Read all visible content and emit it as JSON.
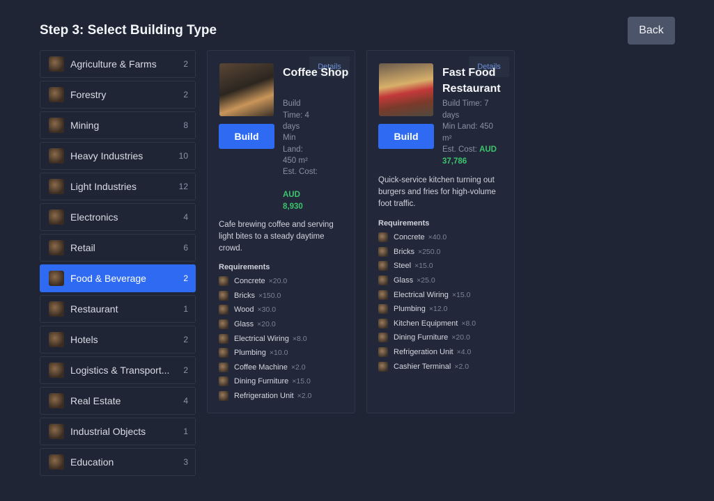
{
  "header": {
    "title": "Step 3: Select Building Type",
    "back_label": "Back"
  },
  "categories": [
    {
      "label": "Agriculture & Farms",
      "count": "2",
      "icon": "farm-icon"
    },
    {
      "label": "Forestry",
      "count": "2",
      "icon": "forestry-icon"
    },
    {
      "label": "Mining",
      "count": "8",
      "icon": "mining-icon"
    },
    {
      "label": "Heavy Industries",
      "count": "10",
      "icon": "heavy-industry-icon"
    },
    {
      "label": "Light Industries",
      "count": "12",
      "icon": "light-industry-icon"
    },
    {
      "label": "Electronics",
      "count": "4",
      "icon": "electronics-icon"
    },
    {
      "label": "Retail",
      "count": "6",
      "icon": "retail-icon"
    },
    {
      "label": "Food & Beverage",
      "count": "2",
      "icon": "food-beverage-icon",
      "active": true
    },
    {
      "label": "Restaurant",
      "count": "1",
      "icon": "restaurant-icon"
    },
    {
      "label": "Hotels",
      "count": "2",
      "icon": "hotel-icon"
    },
    {
      "label": "Logistics & Transport...",
      "count": "2",
      "icon": "logistics-icon"
    },
    {
      "label": "Real Estate",
      "count": "4",
      "icon": "real-estate-icon"
    },
    {
      "label": "Industrial Objects",
      "count": "1",
      "icon": "industrial-objects-icon"
    },
    {
      "label": "Education",
      "count": "3",
      "icon": "education-icon"
    }
  ],
  "buildings": [
    {
      "name": "Coffee Shop",
      "details_label": "Details",
      "build_label": "Build",
      "build_time": "Build Time: 4 days",
      "min_land": "Min Land: 450 m²",
      "cost_label": "Est. Cost:",
      "cost_value": "AUD 8,930",
      "description": "Cafe brewing coffee and serving light bites to a steady daytime crowd.",
      "requirements_title": "Requirements",
      "requirements": [
        {
          "name": "Concrete",
          "qty": "×20.0"
        },
        {
          "name": "Bricks",
          "qty": "×150.0"
        },
        {
          "name": "Wood",
          "qty": "×30.0"
        },
        {
          "name": "Glass",
          "qty": "×20.0"
        },
        {
          "name": "Electrical Wiring",
          "qty": "×8.0"
        },
        {
          "name": "Plumbing",
          "qty": "×10.0"
        },
        {
          "name": "Coffee Machine",
          "qty": "×2.0"
        },
        {
          "name": "Dining Furniture",
          "qty": "×15.0"
        },
        {
          "name": "Refrigeration Unit",
          "qty": "×2.0"
        }
      ]
    },
    {
      "name": "Fast Food Restaurant",
      "details_label": "Details",
      "build_label": "Build",
      "build_time": "Build Time: 7 days",
      "min_land": "Min Land: 450 m²",
      "cost_label": "Est. Cost:",
      "cost_value": "AUD 37,786",
      "description": "Quick-service kitchen turning out burgers and fries for high-volume foot traffic.",
      "requirements_title": "Requirements",
      "requirements": [
        {
          "name": "Concrete",
          "qty": "×40.0"
        },
        {
          "name": "Bricks",
          "qty": "×250.0"
        },
        {
          "name": "Steel",
          "qty": "×15.0"
        },
        {
          "name": "Glass",
          "qty": "×25.0"
        },
        {
          "name": "Electrical Wiring",
          "qty": "×15.0"
        },
        {
          "name": "Plumbing",
          "qty": "×12.0"
        },
        {
          "name": "Kitchen Equipment",
          "qty": "×8.0"
        },
        {
          "name": "Dining Furniture",
          "qty": "×20.0"
        },
        {
          "name": "Refrigeration Unit",
          "qty": "×4.0"
        },
        {
          "name": "Cashier Terminal",
          "qty": "×2.0"
        }
      ]
    }
  ]
}
